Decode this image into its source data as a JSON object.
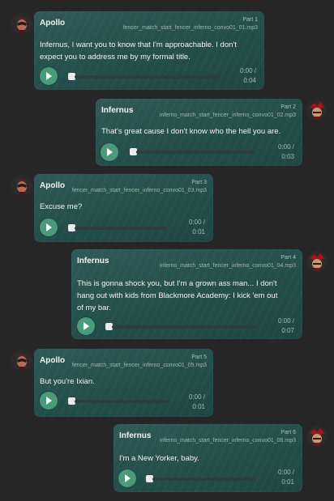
{
  "messages": [
    {
      "speaker": "Apollo",
      "part": "Part 1",
      "file": "fencer_match_start_fencer_inferno_convo01_01.mp3",
      "text_lines": [
        "Infernus, I want you to know that I'm approachable. I don't",
        "expect you to address me by my formal title."
      ],
      "time_current": "0:00 /",
      "time_total": "0:04",
      "progress": 0,
      "avatar_icon": "apollo-avatar-icon"
    },
    {
      "speaker": "Infernus",
      "part": "Part 2",
      "file": "inferno_match_start_fencer_inferno_convo01_02.mp3",
      "text_lines": [
        "That's great cause I don't know who the hell you are."
      ],
      "time_current": "0:00 /",
      "time_total": "0:03",
      "progress": 0,
      "avatar_icon": "infernus-avatar-icon"
    },
    {
      "speaker": "Apollo",
      "part": "Part 3",
      "file": "fencer_match_start_fencer_inferno_convo01_03.mp3",
      "text_lines": [
        "Excuse me?"
      ],
      "time_current": "0:00 /",
      "time_total": "0:01",
      "progress": 0,
      "avatar_icon": "apollo-avatar-icon"
    },
    {
      "speaker": "Infernus",
      "part": "Part 4",
      "file": "inferno_match_start_fencer_inferno_convo01_04.mp3",
      "text_lines": [
        "This is gonna shock you, but I'm a grown ass man... I don't",
        "hang out with kids from Blackmore Academy: I kick 'em out",
        "of my bar."
      ],
      "time_current": "0:00 /",
      "time_total": "0:07",
      "progress": 0,
      "avatar_icon": "infernus-avatar-icon"
    },
    {
      "speaker": "Apollo",
      "part": "Part 5",
      "file": "fencer_match_start_fencer_inferno_convo01_05.mp3",
      "text_lines": [
        "But you're Ixian."
      ],
      "time_current": "0:00 /",
      "time_total": "0:01",
      "progress": 0,
      "avatar_icon": "apollo-avatar-icon"
    },
    {
      "speaker": "Infernus",
      "part": "Part 6",
      "file": "inferno_match_start_fencer_inferno_convo01_06.mp3",
      "text_lines": [
        "I'm a New Yorker, baby."
      ],
      "time_current": "0:00 /",
      "time_total": "0:01",
      "progress": 0,
      "avatar_icon": "infernus-avatar-icon"
    }
  ]
}
